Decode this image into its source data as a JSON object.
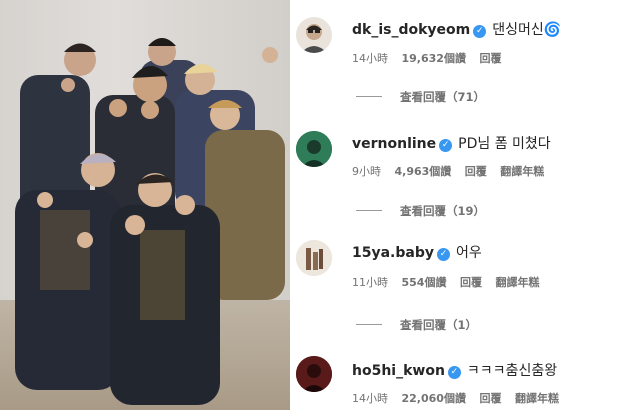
{
  "comments": [
    {
      "username": "dk_is_dokyeom",
      "verified": true,
      "text": "댄싱머신🌀",
      "time": "14小時",
      "likes": "19,632個讚",
      "reply_label": "回覆",
      "translate_label": "",
      "view_replies": "查看回覆（71）"
    },
    {
      "username": "vernonline",
      "verified": true,
      "text": "PD님 폼 미쳤다",
      "time": "9小時",
      "likes": "4,963個讚",
      "reply_label": "回覆",
      "translate_label": "翻譯年糕",
      "view_replies": "查看回覆（19）"
    },
    {
      "username": "15ya.baby",
      "verified": true,
      "text": "어우",
      "time": "11小時",
      "likes": "554個讚",
      "reply_label": "回覆",
      "translate_label": "翻譯年糕",
      "view_replies": "查看回覆（1）"
    },
    {
      "username": "ho5hi_kwon",
      "verified": true,
      "text": "ㅋㅋㅋ춤신춤왕",
      "time": "14小時",
      "likes": "22,060個讚",
      "reply_label": "回覆",
      "translate_label": "翻譯年糕",
      "view_replies": ""
    }
  ]
}
